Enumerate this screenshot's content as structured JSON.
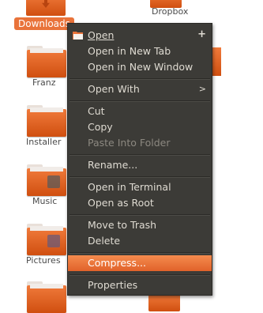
{
  "desktop": {
    "selected_folder_label": "Downloads",
    "top_right_label_partial": "Dropbox",
    "folders": [
      {
        "label": "Franz"
      },
      {
        "label": "Installer"
      },
      {
        "label": "Music"
      },
      {
        "label": "Pictures"
      }
    ]
  },
  "menu": {
    "items": [
      {
        "label": "Open",
        "suffix": "+",
        "icon": "folder-open-icon"
      },
      {
        "label": "Open in New Tab"
      },
      {
        "label": "Open in New Window"
      },
      {
        "label": "Open With",
        "suffix": ">"
      },
      {
        "label": "Cut"
      },
      {
        "label": "Copy"
      },
      {
        "label": "Paste Into Folder",
        "disabled": true
      },
      {
        "label": "Rename..."
      },
      {
        "label": "Open in Terminal"
      },
      {
        "label": "Open as Root"
      },
      {
        "label": "Move to Trash"
      },
      {
        "label": "Delete"
      },
      {
        "label": "Compress...",
        "highlighted": true
      },
      {
        "label": "Properties"
      }
    ]
  },
  "colors": {
    "menu_bg": "#3c3b37",
    "highlight": "#e9733a",
    "folder": "#e3621f"
  }
}
